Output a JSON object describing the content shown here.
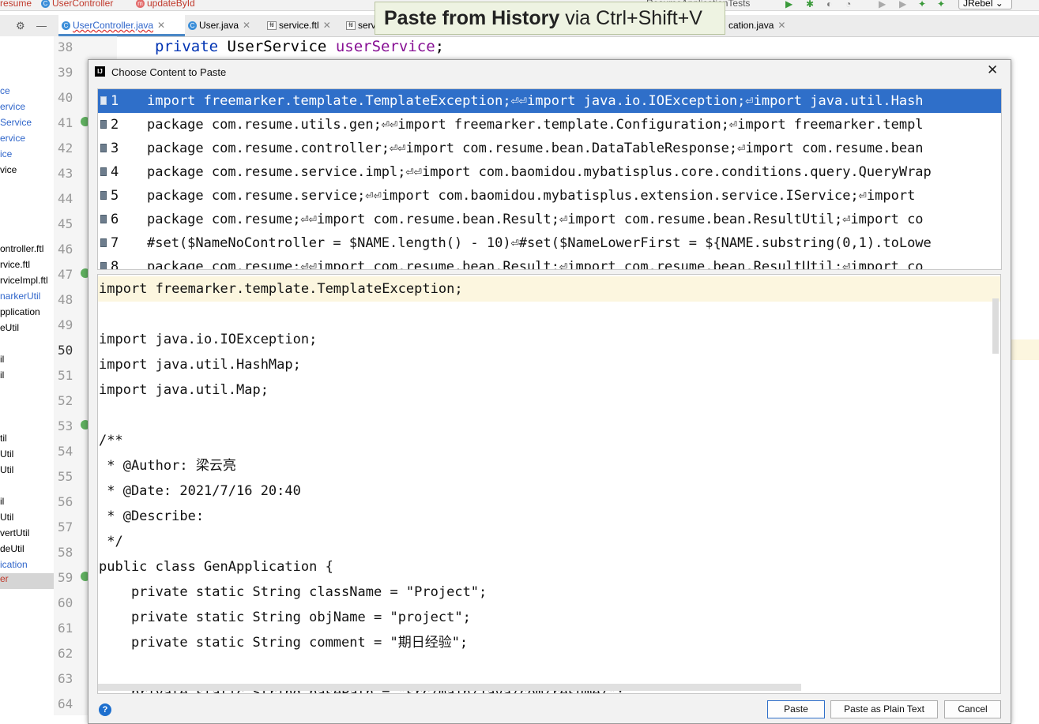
{
  "breadcrumb": {
    "item1": "resume",
    "item2": "UserController",
    "item3": "updateById"
  },
  "run_config": {
    "label": "ResumeApplicationTests",
    "jrebel": "JRebel"
  },
  "tabs": [
    {
      "label": "UserController.java"
    },
    {
      "label": "User.java"
    },
    {
      "label": "service.ftl"
    },
    {
      "label": "servi"
    },
    {
      "label": "cation.java"
    }
  ],
  "project_tree": {
    "items": [
      "ce",
      "ervice",
      "Service",
      "ervice",
      "ice",
      "vice",
      "ontroller.ftl",
      "rvice.ftl",
      "rviceImpl.ftl",
      "narkerUtil",
      "pplication",
      "eUtil",
      "il",
      "il",
      "til",
      "Util",
      "Util",
      "il",
      "Util",
      "vertUtil",
      "deUtil",
      "ication",
      "er"
    ]
  },
  "editor": {
    "line_numbers": [
      "38",
      "39",
      "40",
      "41",
      "42",
      "43",
      "44",
      "45",
      "46",
      "47",
      "48",
      "49",
      "50",
      "51",
      "52",
      "53",
      "54",
      "55",
      "56",
      "57",
      "58",
      "59",
      "60",
      "61",
      "62",
      "63",
      "64"
    ],
    "visible_code": {
      "kw": "private",
      "type": "UserService",
      "field": "userService",
      "end": ";"
    }
  },
  "hint": {
    "bold": "Paste from History",
    "rest": " via Ctrl+Shift+V"
  },
  "dialog": {
    "title": "Choose Content to Paste",
    "history": [
      {
        "num": "1",
        "text": "import freemarker.template.TemplateException;⏎⏎import java.io.IOException;⏎import java.util.Hash"
      },
      {
        "num": "2",
        "text": "package com.resume.utils.gen;⏎⏎import freemarker.template.Configuration;⏎import freemarker.templ"
      },
      {
        "num": "3",
        "text": "package com.resume.controller;⏎⏎import com.resume.bean.DataTableResponse;⏎import com.resume.bean"
      },
      {
        "num": "4",
        "text": "package com.resume.service.impl;⏎⏎import com.baomidou.mybatisplus.core.conditions.query.QueryWrap"
      },
      {
        "num": "5",
        "text": "package com.resume.service;⏎⏎import com.baomidou.mybatisplus.extension.service.IService;⏎import "
      },
      {
        "num": "6",
        "text": "package com.resume;⏎⏎import com.resume.bean.Result;⏎import com.resume.bean.ResultUtil;⏎import co"
      },
      {
        "num": "7",
        "text": "#set($NameNoController = $NAME.length() - 10)⏎#set($NameLowerFirst = ${NAME.substring(0,1).toLowe"
      },
      {
        "num": "8",
        "text": "package com.resume;⏎⏎import com.resume.bean.Result;⏎import com.resume.bean.ResultUtil;⏎import co"
      }
    ],
    "preview_lines": [
      "import freemarker.template.TemplateException;",
      "",
      "import java.io.IOException;",
      "import java.util.HashMap;",
      "import java.util.Map;",
      "",
      "/**",
      " * @Author: 梁云亮",
      " * @Date: 2021/7/16 20:40",
      " * @Describe:",
      " */",
      "public class GenApplication {",
      "    private static String className = \"Project\";",
      "    private static String objName = \"project\";",
      "    private static String comment = \"期日经验\";",
      "",
      "    private static String basePath = \"src/main/java/com/resume/\";"
    ],
    "buttons": {
      "paste": "Paste",
      "paste_plain": "Paste as Plain Text",
      "cancel": "Cancel"
    },
    "help": "?"
  },
  "colors": {
    "selection": "#2f6fc9",
    "caret_line": "#fcf6df",
    "link": "#2f65ca"
  }
}
